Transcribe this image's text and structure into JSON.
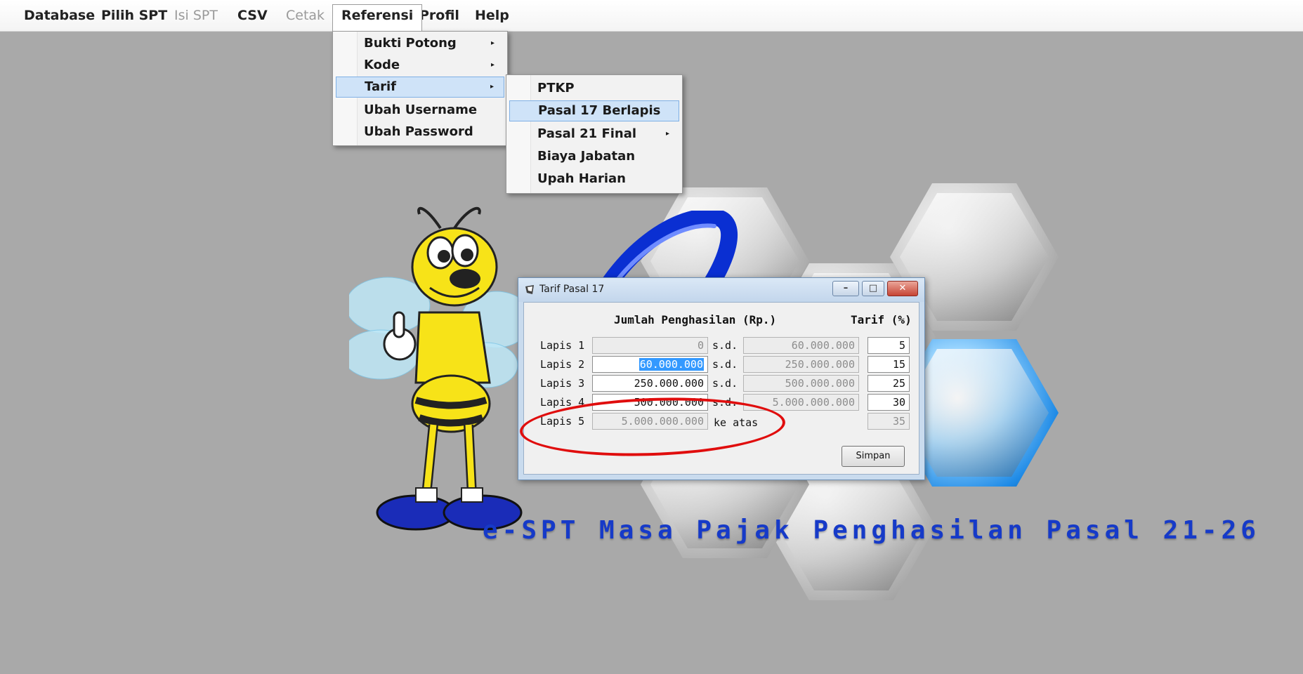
{
  "menubar": {
    "items": [
      {
        "label": "Database",
        "state": "enabled"
      },
      {
        "label": "Pilih SPT",
        "state": "enabled"
      },
      {
        "label": "Isi SPT",
        "state": "disabled"
      },
      {
        "label": "CSV",
        "state": "enabled"
      },
      {
        "label": "Cetak",
        "state": "disabled"
      },
      {
        "label": "Referensi",
        "state": "open"
      },
      {
        "label": "Profil",
        "state": "enabled"
      },
      {
        "label": "Help",
        "state": "enabled"
      }
    ]
  },
  "referensi_menu": {
    "items": [
      {
        "label": "Bukti Potong",
        "has_submenu": true
      },
      {
        "label": "Kode",
        "has_submenu": true
      },
      {
        "label": "Tarif",
        "has_submenu": true,
        "highlighted": true
      },
      {
        "label": "Ubah Username",
        "has_submenu": false
      },
      {
        "label": "Ubah Password",
        "has_submenu": false
      }
    ]
  },
  "tarif_submenu": {
    "items": [
      {
        "label": "PTKP",
        "has_submenu": false
      },
      {
        "label": "Pasal 17 Berlapis",
        "has_submenu": false,
        "highlighted": true
      },
      {
        "label": "Pasal 21 Final",
        "has_submenu": true
      },
      {
        "label": "Biaya Jabatan",
        "has_submenu": false
      },
      {
        "label": "Upah Harian",
        "has_submenu": false
      }
    ]
  },
  "dialog": {
    "title": "Tarif Pasal 17",
    "header_income": "Jumlah Penghasilan (Rp.)",
    "header_rate": "Tarif (%)",
    "sd_label": "s.d.",
    "above_label": "ke atas",
    "rows": [
      {
        "label": "Lapis 1",
        "from": "0",
        "to": "60.000.000",
        "rate": "5"
      },
      {
        "label": "Lapis 2",
        "from": "60.000.000",
        "to": "250.000.000",
        "rate": "15"
      },
      {
        "label": "Lapis 3",
        "from": "250.000.000",
        "to": "500.000.000",
        "rate": "25"
      },
      {
        "label": "Lapis 4",
        "from": "500.000.000",
        "to": "5.000.000.000",
        "rate": "30"
      },
      {
        "label": "Lapis 5",
        "from": "5.000.000.000",
        "to": "",
        "rate": "35"
      }
    ],
    "save_label": "Simpan",
    "minimize_glyph": "–",
    "maximize_glyph": "□",
    "close_glyph": "✕",
    "annotation_color": "#e00d0d"
  },
  "brand": {
    "title": "e-SPT Masa Pajak Penghasilan Pasal 21-26",
    "color": "#163ac8"
  },
  "icons": {
    "submenu_arrow": "▸"
  }
}
